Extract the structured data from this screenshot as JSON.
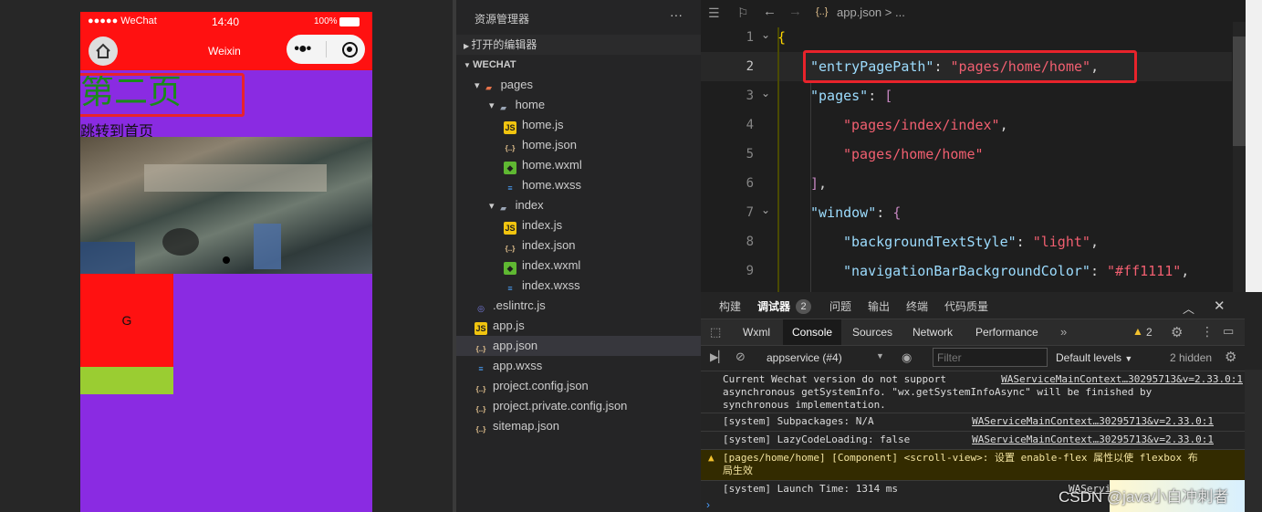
{
  "simulator": {
    "status_carrier": "●●●●● WeChat",
    "status_time": "14:40",
    "status_battery": "100%",
    "nav_title": "Weixin",
    "page_title": "第二页",
    "link_text": "跳转到首页",
    "box_letter": "G"
  },
  "explorer": {
    "title": "资源管理器",
    "more": "···",
    "open_editors": "打开的编辑器",
    "project": "WECHAT",
    "items": [
      {
        "label": "pages",
        "kind": "folder-open"
      },
      {
        "label": "home",
        "kind": "folder-open"
      },
      {
        "label": "home.js",
        "kind": "js"
      },
      {
        "label": "home.json",
        "kind": "json"
      },
      {
        "label": "home.wxml",
        "kind": "wxml"
      },
      {
        "label": "home.wxss",
        "kind": "wxss"
      },
      {
        "label": "index",
        "kind": "folder-open"
      },
      {
        "label": "index.js",
        "kind": "js"
      },
      {
        "label": "index.json",
        "kind": "json"
      },
      {
        "label": "index.wxml",
        "kind": "wxml"
      },
      {
        "label": "index.wxss",
        "kind": "wxss"
      },
      {
        "label": ".eslintrc.js",
        "kind": "eslint"
      },
      {
        "label": "app.js",
        "kind": "js"
      },
      {
        "label": "app.json",
        "kind": "json"
      },
      {
        "label": "app.wxss",
        "kind": "wxss"
      },
      {
        "label": "project.config.json",
        "kind": "json"
      },
      {
        "label": "project.private.config.json",
        "kind": "json"
      },
      {
        "label": "sitemap.json",
        "kind": "json"
      }
    ]
  },
  "editor": {
    "breadcrumb": "app.json > ...",
    "lines": [
      {
        "num": "1",
        "parts": [
          [
            "b",
            "{"
          ]
        ]
      },
      {
        "num": "2",
        "parts": [
          [
            "k",
            "\"entryPagePath\""
          ],
          [
            "p",
            ": "
          ],
          [
            "s",
            "\"pages/home/home\""
          ],
          [
            "p",
            ","
          ]
        ]
      },
      {
        "num": "3",
        "parts": [
          [
            "k",
            "\"pages\""
          ],
          [
            "p",
            ": "
          ],
          [
            "b",
            "["
          ]
        ]
      },
      {
        "num": "4",
        "parts": [
          [
            "s",
            "\"pages/index/index\""
          ],
          [
            "p",
            ","
          ]
        ]
      },
      {
        "num": "5",
        "parts": [
          [
            "s",
            "\"pages/home/home\""
          ]
        ]
      },
      {
        "num": "6",
        "parts": [
          [
            "b",
            "]"
          ],
          [
            "p",
            ","
          ]
        ]
      },
      {
        "num": "7",
        "parts": [
          [
            "k",
            "\"window\""
          ],
          [
            "p",
            ": "
          ],
          [
            "b",
            "{"
          ]
        ]
      },
      {
        "num": "8",
        "parts": [
          [
            "k",
            "\"backgroundTextStyle\""
          ],
          [
            "p",
            ": "
          ],
          [
            "s",
            "\"light\""
          ],
          [
            "p",
            ","
          ]
        ]
      },
      {
        "num": "9",
        "parts": [
          [
            "k",
            "\"navigationBarBackgroundColor\""
          ],
          [
            "p",
            ": "
          ],
          [
            "s",
            "\"#ff1111\""
          ],
          [
            "p",
            ","
          ]
        ]
      }
    ]
  },
  "devtools": {
    "top_tabs": [
      "构建",
      "调试器",
      "问题",
      "输出",
      "终端",
      "代码质量"
    ],
    "debugger_badge": "2",
    "panel_tabs": [
      "Wxml",
      "Console",
      "Sources",
      "Network",
      "Performance"
    ],
    "warn_count": "2",
    "context": "appservice (#4)",
    "filter_placeholder": "Filter",
    "levels": "Default levels",
    "hidden": "2 hidden",
    "logs": [
      {
        "text": "Current Wechat version do not support\nasynchronous getSystemInfo. \"wx.getSystemInfoAsync\" will be finished by\nsynchronous implementation.",
        "source": "WAServiceMainContext…30295713&v=2.33.0:1",
        "warn": false
      },
      {
        "text": "[system] Subpackages: N/A",
        "source": "WAServiceMainContext…30295713&v=2.33.0:1",
        "warn": false
      },
      {
        "text": "[system] LazyCodeLoading: false",
        "source": "WAServiceMainContext…30295713&v=2.33.0:1",
        "warn": false
      },
      {
        "text": "[pages/home/home] [Component] <scroll-view>: 设置 enable-flex 属性以使 flexbox 布\n局生效",
        "source": "",
        "warn": true
      },
      {
        "text": "[system] Launch Time: 1314 ms",
        "source": "WAServiceMainContext…302",
        "warn": false
      }
    ],
    "watermark": "CSDN @java小白冲刺者"
  }
}
